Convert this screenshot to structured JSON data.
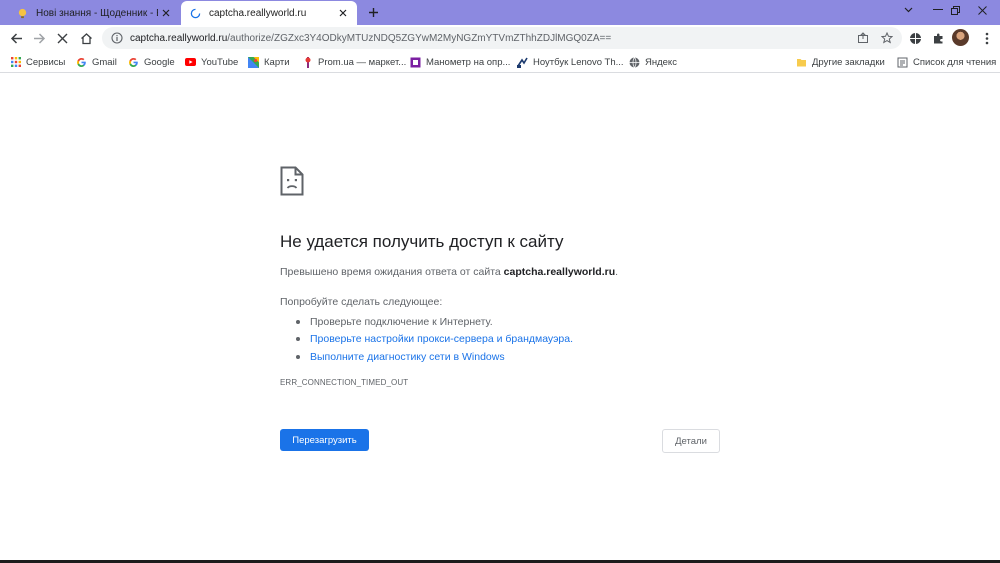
{
  "tabs": [
    {
      "title": "Нові знання - Щоденник - Елек",
      "state": "inactive"
    },
    {
      "title": "captcha.reallyworld.ru",
      "state": "active",
      "loading": true
    }
  ],
  "toolbar": {
    "url_host": "captcha.reallyworld.ru",
    "url_path": "/authorize/ZGZxc3Y4ODkyMTUzNDQ5ZGYwM2MyNGZmYTVmZThhZDJlMGQ0ZA=="
  },
  "bookmarks": [
    {
      "label": "Сервисы",
      "icon": "apps-icon"
    },
    {
      "label": "Gmail",
      "icon": "google-icon"
    },
    {
      "label": "Google",
      "icon": "google-icon"
    },
    {
      "label": "YouTube",
      "icon": "youtube-icon"
    },
    {
      "label": "Карти",
      "icon": "maps-icon"
    },
    {
      "label": "Prom.ua — маркет...",
      "icon": "prom-icon"
    },
    {
      "label": "Манометр на опр...",
      "icon": "page-icon"
    },
    {
      "label": "Ноутбук Lenovo Th...",
      "icon": "page-icon"
    },
    {
      "label": "Яндекс",
      "icon": "globe-icon"
    }
  ],
  "bookmarks_right": [
    {
      "label": "Другие закладки",
      "icon": "folder-icon"
    },
    {
      "label": "Список для чтения",
      "icon": "reading-list-icon"
    }
  ],
  "error": {
    "heading": "Не удается получить доступ к сайту",
    "message_prefix": "Превышено время ожидания ответа от сайта ",
    "host": "captcha.reallyworld.ru",
    "message_suffix": ".",
    "try_label": "Попробуйте сделать следующее:",
    "suggestions": [
      {
        "text": "Проверьте подключение к Интернету.",
        "link": false
      },
      {
        "text": "Проверьте настройки прокси-сервера и брандмауэра.",
        "link": true
      },
      {
        "text": "Выполните диагностику сети в Windows",
        "link": true
      }
    ],
    "code": "ERR_CONNECTION_TIMED_OUT",
    "reload_label": "Перезагрузить",
    "details_label": "Детали"
  },
  "colors": {
    "tabstrip": "#8c89e0",
    "accent": "#1a73e8",
    "text": "#202124",
    "secondary_text": "#5f6368"
  }
}
